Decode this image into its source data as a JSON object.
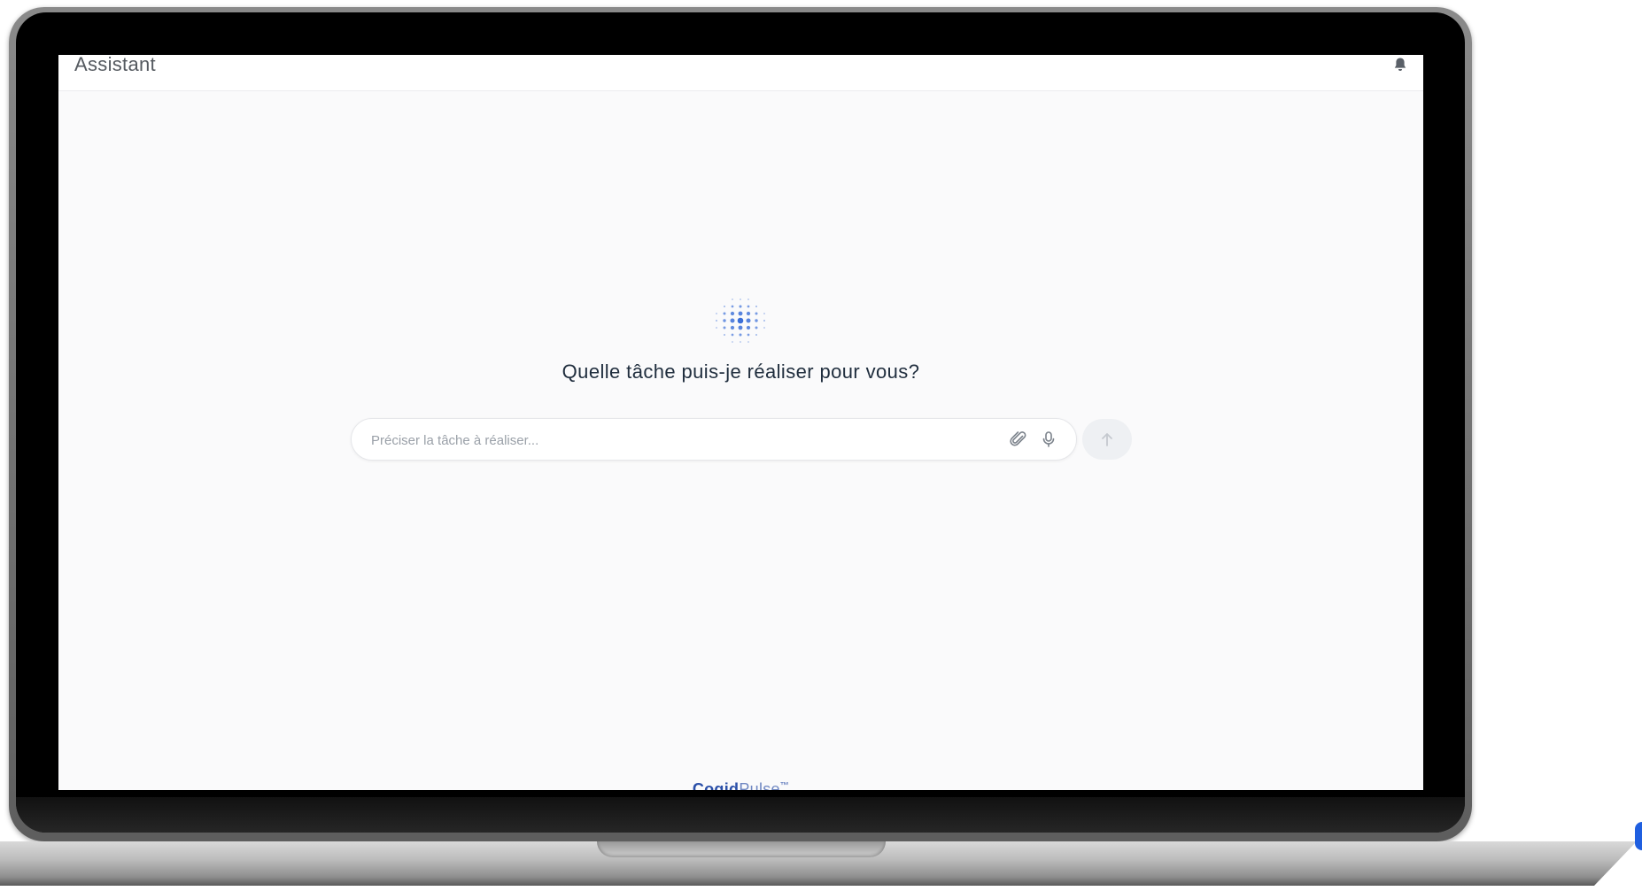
{
  "header": {
    "title": "Assistant",
    "notification_icon": "bell-icon"
  },
  "main": {
    "logo_icon": "dot-grid-logo-icon",
    "heading": "Quelle tâche puis-je réaliser pour vous?",
    "input": {
      "placeholder": "Préciser la tâche à réaliser...",
      "value": ""
    },
    "attach_icon": "paperclip-icon",
    "mic_icon": "microphone-icon",
    "send_icon": "arrow-up-icon"
  },
  "footer": {
    "brand_bold": "Cogid",
    "brand_light": "Pulse",
    "brand_mark": "™"
  },
  "colors": {
    "accent": "#2a4fa8",
    "logo_blue": "#3b6fd8",
    "page_bg": "#fafafb"
  }
}
